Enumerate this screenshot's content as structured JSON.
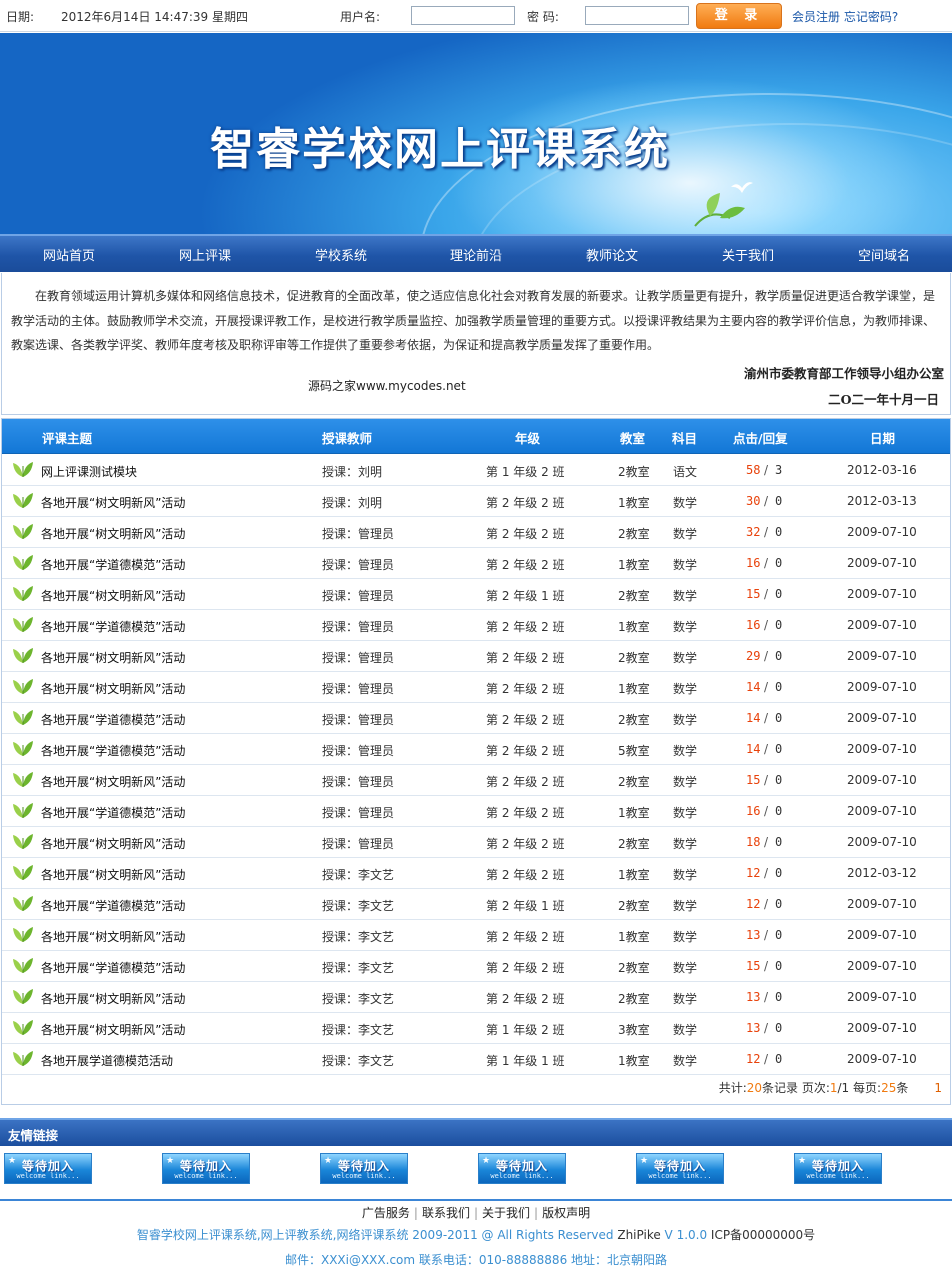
{
  "top": {
    "date_label": "日期:",
    "date_value": "2012年6月14日  14:47:39 星期四",
    "username_label": "用户名:",
    "password_label": "密  码:",
    "login_button": "登 录",
    "register_link": "会员注册",
    "forgot_link": "忘记密码?"
  },
  "banner": {
    "title": "智睿学校网上评课系统"
  },
  "nav": [
    "网站首页",
    "网上评课",
    "学校系统",
    "理论前沿",
    "教师论文",
    "关于我们",
    "空间域名"
  ],
  "intro": {
    "text": "在教育领域运用计算机多媒体和网络信息技术，促进教育的全面改革，使之适应信息化社会对教育发展的新要求。让教学质量更有提升，教学质量促进更适合教学课堂，是教学活动的主体。鼓励教师学术交流，开展授课评教工作，是校进行教学质量监控、加强教学质量管理的重要方式。以授课评教结果为主要内容的教学评价信息，为教师排课、教案选课、各类教学评奖、教师年度考核及职称评审等工作提供了重要参考依据，为保证和提高教学质量发挥了重要作用。",
    "source": "源码之家www.mycodes.net",
    "org": "渝州市委教育部工作领导小组办公室",
    "date": "二O二一年十月一日"
  },
  "table": {
    "headers": {
      "topic": "评课主题",
      "teacher": "授课教师",
      "grade": "年级",
      "room": "教室",
      "subject": "科目",
      "clicks": "点击/回复",
      "date": "日期"
    },
    "rows": [
      {
        "topic": "网上评课测试模块",
        "teacher": "授课：刘明",
        "grade": "第 1 年级 2 班",
        "room": "2教室",
        "subject": "语文",
        "clicks": "58",
        "replies": "3",
        "date": "2012-03-16"
      },
      {
        "topic": "各地开展“树文明新风”活动",
        "teacher": "授课：刘明",
        "grade": "第 2 年级 2 班",
        "room": "1教室",
        "subject": "数学",
        "clicks": "30",
        "replies": "0",
        "date": "2012-03-13"
      },
      {
        "topic": "各地开展“树文明新风”活动",
        "teacher": "授课：管理员",
        "grade": "第 2 年级 2 班",
        "room": "2教室",
        "subject": "数学",
        "clicks": "32",
        "replies": "0",
        "date": "2009-07-10"
      },
      {
        "topic": "各地开展“学道德模范”活动",
        "teacher": "授课：管理员",
        "grade": "第 2 年级 2 班",
        "room": "1教室",
        "subject": "数学",
        "clicks": "16",
        "replies": "0",
        "date": "2009-07-10"
      },
      {
        "topic": "各地开展“树文明新风”活动",
        "teacher": "授课：管理员",
        "grade": "第 2 年级 1 班",
        "room": "2教室",
        "subject": "数学",
        "clicks": "15",
        "replies": "0",
        "date": "2009-07-10"
      },
      {
        "topic": "各地开展“学道德模范”活动",
        "teacher": "授课：管理员",
        "grade": "第 2 年级 2 班",
        "room": "1教室",
        "subject": "数学",
        "clicks": "16",
        "replies": "0",
        "date": "2009-07-10"
      },
      {
        "topic": "各地开展“树文明新风”活动",
        "teacher": "授课：管理员",
        "grade": "第 2 年级 2 班",
        "room": "2教室",
        "subject": "数学",
        "clicks": "29",
        "replies": "0",
        "date": "2009-07-10"
      },
      {
        "topic": "各地开展“树文明新风”活动",
        "teacher": "授课：管理员",
        "grade": "第 2 年级 2 班",
        "room": "1教室",
        "subject": "数学",
        "clicks": "14",
        "replies": "0",
        "date": "2009-07-10"
      },
      {
        "topic": "各地开展“学道德模范”活动",
        "teacher": "授课：管理员",
        "grade": "第 2 年级 2 班",
        "room": "2教室",
        "subject": "数学",
        "clicks": "14",
        "replies": "0",
        "date": "2009-07-10"
      },
      {
        "topic": "各地开展“学道德模范”活动",
        "teacher": "授课：管理员",
        "grade": "第 2 年级 2 班",
        "room": "5教室",
        "subject": "数学",
        "clicks": "14",
        "replies": "0",
        "date": "2009-07-10"
      },
      {
        "topic": "各地开展“树文明新风”活动",
        "teacher": "授课：管理员",
        "grade": "第 2 年级 2 班",
        "room": "2教室",
        "subject": "数学",
        "clicks": "15",
        "replies": "0",
        "date": "2009-07-10"
      },
      {
        "topic": "各地开展“学道德模范”活动",
        "teacher": "授课：管理员",
        "grade": "第 2 年级 2 班",
        "room": "1教室",
        "subject": "数学",
        "clicks": "16",
        "replies": "0",
        "date": "2009-07-10"
      },
      {
        "topic": "各地开展“树文明新风”活动",
        "teacher": "授课：管理员",
        "grade": "第 2 年级 2 班",
        "room": "2教室",
        "subject": "数学",
        "clicks": "18",
        "replies": "0",
        "date": "2009-07-10"
      },
      {
        "topic": "各地开展“树文明新风”活动",
        "teacher": "授课：李文艺",
        "grade": "第 2 年级 2 班",
        "room": "1教室",
        "subject": "数学",
        "clicks": "12",
        "replies": "0",
        "date": "2012-03-12"
      },
      {
        "topic": "各地开展“学道德模范”活动",
        "teacher": "授课：李文艺",
        "grade": "第 2 年级 1 班",
        "room": "2教室",
        "subject": "数学",
        "clicks": "12",
        "replies": "0",
        "date": "2009-07-10"
      },
      {
        "topic": "各地开展“树文明新风”活动",
        "teacher": "授课：李文艺",
        "grade": "第 2 年级 2 班",
        "room": "1教室",
        "subject": "数学",
        "clicks": "13",
        "replies": "0",
        "date": "2009-07-10"
      },
      {
        "topic": "各地开展“学道德模范”活动",
        "teacher": "授课：李文艺",
        "grade": "第 2 年级 2 班",
        "room": "2教室",
        "subject": "数学",
        "clicks": "15",
        "replies": "0",
        "date": "2009-07-10"
      },
      {
        "topic": "各地开展“树文明新风”活动",
        "teacher": "授课：李文艺",
        "grade": "第 2 年级 2 班",
        "room": "2教室",
        "subject": "数学",
        "clicks": "13",
        "replies": "0",
        "date": "2009-07-10"
      },
      {
        "topic": "各地开展“树文明新风”活动",
        "teacher": "授课：李文艺",
        "grade": "第 1 年级 2 班",
        "room": "3教室",
        "subject": "数学",
        "clicks": "13",
        "replies": "0",
        "date": "2009-07-10"
      },
      {
        "topic": "各地开展学道德模范活动",
        "teacher": "授课：李文艺",
        "grade": "第 1 年级 1 班",
        "room": "1教室",
        "subject": "数学",
        "clicks": "12",
        "replies": "0",
        "date": "2009-07-10"
      }
    ],
    "pager": {
      "total_label": "共计:",
      "total": "20",
      "records_label": "条记录 页次:",
      "page": "1",
      "pages": "/1 每页:",
      "per_page": "25",
      "per_unit": "条",
      "page_link": "1"
    }
  },
  "links": {
    "title": "友情链接",
    "items": [
      "等待加入",
      "等待加入",
      "等待加入",
      "等待加入",
      "等待加入",
      "等待加入"
    ],
    "sub": "welcome link..."
  },
  "footer": {
    "nav": [
      "广告服务",
      "联系我们",
      "关于我们",
      "版权声明"
    ],
    "copy_a": "智睿学校网上评课系统,网上评教系统,网络评课系统  2009-2011 @ All Rights Reserved ",
    "copy_brand": "ZhiPike",
    "copy_ver": " V 1.0.0 ",
    "copy_icp": "ICP备00000000号",
    "contact": "邮件：XXXi@XXX.com 联系电话：010-88888886     地址：北京朝阳路"
  },
  "colors": {
    "accent": "#1377d6",
    "nav": "#1f55a8",
    "login_button": "#f07a10",
    "clicks": "#e8420b"
  },
  "icons": [
    "leaf-icon",
    "bird-icon",
    "star-icon"
  ]
}
